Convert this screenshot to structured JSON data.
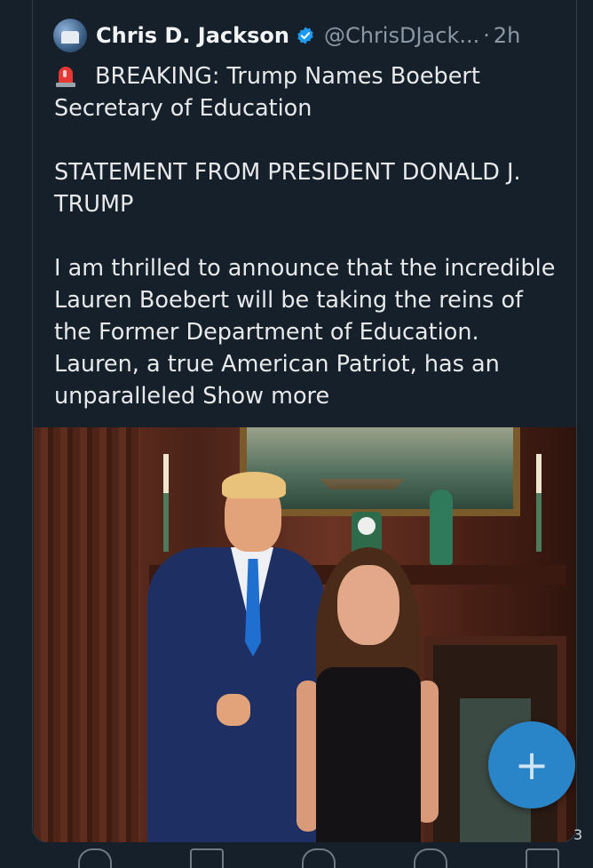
{
  "tweet": {
    "author_name": "Chris D. Jackson",
    "handle": "@ChrisDJack...",
    "separator": "·",
    "time": "2h",
    "lines": [
      "BREAKING: Trump Names Boebert",
      "Secretary of Education",
      "",
      "STATEMENT FROM PRESIDENT DONALD J.",
      "TRUMP",
      "",
      "I am thrilled to announce that the incredible",
      "Lauren Boebert will be taking the reins of",
      "the Former Department of Education.",
      "Lauren, a true American Patriot, has an",
      "unparalleled"
    ],
    "show_more": "Show more"
  },
  "compose_button": {
    "icon": "plus-icon",
    "glyph": "+"
  },
  "edge_text": "3",
  "colors": {
    "background": "#15202b",
    "accent": "#2a85c8",
    "verified": "#1d9bf0",
    "muted": "#8b98a5"
  }
}
